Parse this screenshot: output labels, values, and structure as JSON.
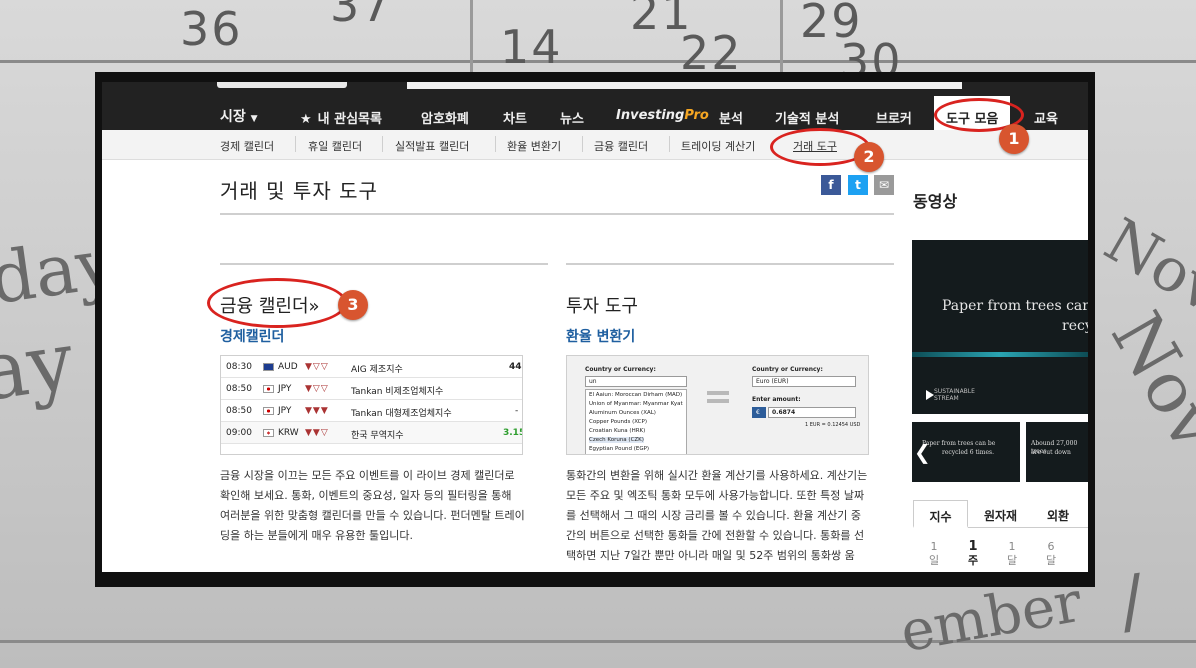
{
  "background": {
    "numbers": [
      "36",
      "37",
      "21",
      "29",
      "14",
      "22",
      "30"
    ],
    "words": [
      "day",
      "ay",
      "Nov",
      "Nove",
      "ember",
      "/"
    ]
  },
  "nav": {
    "items": [
      {
        "label": "시장",
        "has_dropdown": true,
        "dropdown_icon": "chevron-down-icon"
      },
      {
        "label": "내 관심목록",
        "icon": "star-icon"
      },
      {
        "label": "암호화폐"
      },
      {
        "label": "차트"
      },
      {
        "label": "뉴스"
      },
      {
        "label_main": "Investing",
        "label_accent": "Pro"
      },
      {
        "label": "분석"
      },
      {
        "label": "기술적 분석"
      },
      {
        "label": "브로커"
      },
      {
        "label": "도구 모음",
        "active": true
      },
      {
        "label": "교육"
      }
    ]
  },
  "subnav": {
    "items": [
      {
        "label": "경제 캘린더"
      },
      {
        "label": "휴일 캘린더"
      },
      {
        "label": "실적발표 캘린더"
      },
      {
        "label": "환율 변환기"
      },
      {
        "label": "금융 캘린더"
      },
      {
        "label": "트레이딩 계산기"
      },
      {
        "label": "거래 도구",
        "current": true
      }
    ]
  },
  "annotations": {
    "badge1": "1",
    "badge2": "2",
    "badge3": "3",
    "color": "#d9231f"
  },
  "page": {
    "title": "거래 및 투자 도구",
    "share": {
      "facebook": "f",
      "twitter": "t",
      "email": "✉"
    }
  },
  "left_section": {
    "title": "금융 캘린더",
    "title_suffix": "»",
    "link": "경제캘린더",
    "events": [
      {
        "time": "08:30",
        "currency": "AUD",
        "name": "AIG 제조지수",
        "value": "44.",
        "value_color": "#222222"
      },
      {
        "time": "08:50",
        "currency": "JPY",
        "name": "Tankan 비제조업체지수",
        "value": "",
        "value_color": "#222222"
      },
      {
        "time": "08:50",
        "currency": "JPY",
        "name": "Tankan 대형제조업체지수",
        "value": "-",
        "value_color": "#222222"
      },
      {
        "time": "09:00",
        "currency": "KRW",
        "name": "한국 무역지수",
        "value": "3.15",
        "value_color": "#2e9e2e"
      }
    ],
    "description": "금융 시장을 이끄는 모든 주요 이벤트를 이 라이브 경제 캘린더로 확인해 보세요. 통화, 이벤트의 중요성, 일자 등의 필터링을 통해 여러분을 위한 맞춤형 캘린더를 만들 수 있습니다. 펀더멘탈 트레이딩을 하는 분들에게 매우 유용한 툴입니다."
  },
  "right_section": {
    "title": "투자 도구",
    "link": "환율 변환기",
    "converter": {
      "from_label": "Country or Currency:",
      "from_value": "un",
      "options": [
        "El Aaiun: Moroccan Dirham (MAD)",
        "Union of Myanmar: Myanmar Kyat",
        "Aluminum Ounces (XAL)",
        "Copper Pounds (XCP)",
        "Croatian Kuna (HRK)",
        "Czech Koruna (CZK)",
        "Egyptian Pound (EGP)"
      ],
      "to_label": "Country or Currency:",
      "to_value": "Euro (EUR)",
      "amount_label": "Enter amount:",
      "amount_symbol": "€",
      "amount_value": "0.6874",
      "rate": "1 EUR = 0.12454 USD"
    },
    "description": "통화간의 변환을 위해 실시간 환율 계산기를 사용하세요. 계산기는 모든 주요 및 엑조틱 통화 모두에 사용가능합니다. 또한 특정 날짜를 선택해서 그 때의 시장 금리를 볼 수 있습니다. 환율 계산기 중간의 버튼으로 선택한 통화들 간에 전환할 수 있습니다. 통화를 선택하면 지난 7일간 뿐만 아니라 매일 및 52주 범위의 통화쌍 움"
  },
  "sidebar": {
    "title": "동영상",
    "video_main": {
      "line1": "Paper from trees car",
      "line2": "recyc",
      "brand_line1": "SUSTAINABLE",
      "brand_line2": "STREAM"
    },
    "video_thumbs": [
      {
        "line1": "Paper from trees can be",
        "line2": "recycled 6 times."
      },
      {
        "line1": "Abound 27,000 trees",
        "line2": "are cut down"
      }
    ],
    "tabs": [
      {
        "label": "지수",
        "active": true
      },
      {
        "label": "원자재"
      },
      {
        "label": "외환"
      }
    ],
    "periods": [
      {
        "num": "1",
        "unit": "일"
      },
      {
        "num": "1",
        "unit": "주",
        "active": true
      },
      {
        "num": "1",
        "unit": "달"
      },
      {
        "num": "6",
        "unit": "달"
      }
    ]
  },
  "colors": {
    "topbar": "#222222",
    "accent_pro": "#f5a623",
    "link_blue": "#1f5fa0",
    "facebook": "#3b5998",
    "twitter": "#1da1f2",
    "email": "#9a9a9a",
    "badge": "#d8552f"
  }
}
